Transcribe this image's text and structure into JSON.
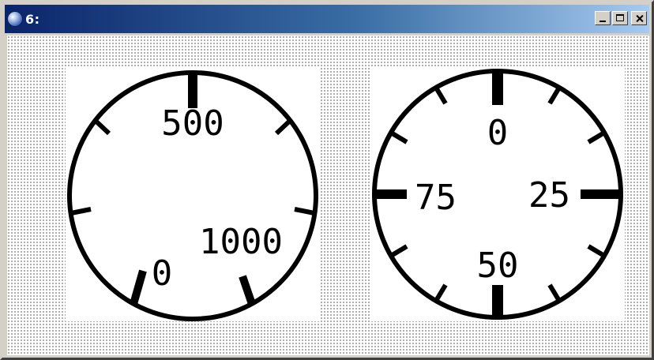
{
  "window": {
    "title": "6:",
    "controls": [
      "minimize",
      "maximize",
      "close"
    ]
  },
  "dials": [
    {
      "name": "dial-left",
      "scale_labels": [
        "500",
        "1000",
        "0"
      ]
    },
    {
      "name": "dial-right",
      "scale_labels": [
        "0",
        "25",
        "50",
        "75"
      ]
    }
  ],
  "colors": {
    "title_start": "#0a246a",
    "title_end": "#a6caf0",
    "ink": "#000000"
  }
}
